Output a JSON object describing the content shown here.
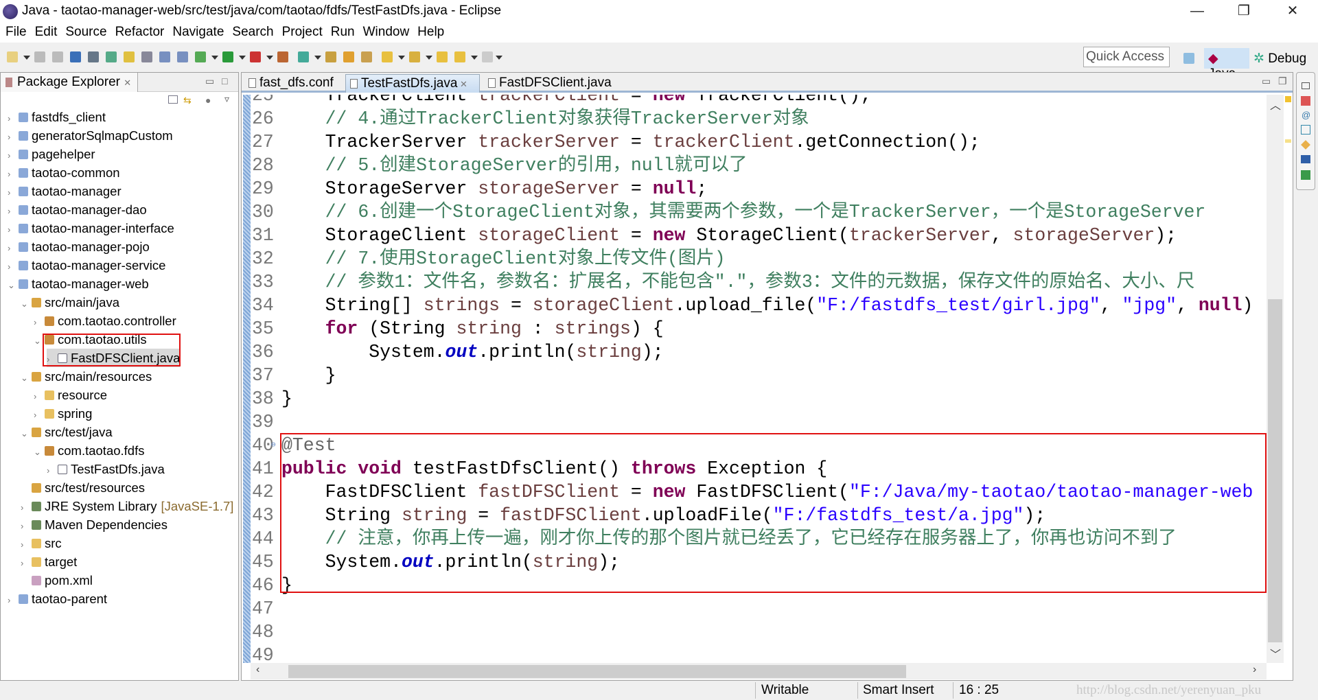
{
  "window": {
    "title": "Java - taotao-manager-web/src/test/java/com/taotao/fdfs/TestFastDfs.java - Eclipse",
    "minimize": "—",
    "restore": "❐",
    "close": "✕"
  },
  "menu": [
    "File",
    "Edit",
    "Source",
    "Refactor",
    "Navigate",
    "Search",
    "Project",
    "Run",
    "Window",
    "Help"
  ],
  "toolbar": {
    "quick_access": "Quick Access",
    "perspectives": {
      "java": "Java",
      "debug": "Debug"
    }
  },
  "package_explorer": {
    "title": "Package Explorer",
    "items": [
      {
        "label": "fastdfs_client",
        "level": 0,
        "state": "collapsed",
        "kind": "project"
      },
      {
        "label": "generatorSqlmapCustom",
        "level": 0,
        "state": "collapsed",
        "kind": "project"
      },
      {
        "label": "pagehelper",
        "level": 0,
        "state": "collapsed",
        "kind": "project"
      },
      {
        "label": "taotao-common",
        "level": 0,
        "state": "collapsed",
        "kind": "project"
      },
      {
        "label": "taotao-manager",
        "level": 0,
        "state": "collapsed",
        "kind": "project"
      },
      {
        "label": "taotao-manager-dao",
        "level": 0,
        "state": "collapsed",
        "kind": "project"
      },
      {
        "label": "taotao-manager-interface",
        "level": 0,
        "state": "collapsed",
        "kind": "project"
      },
      {
        "label": "taotao-manager-pojo",
        "level": 0,
        "state": "collapsed",
        "kind": "project"
      },
      {
        "label": "taotao-manager-service",
        "level": 0,
        "state": "collapsed",
        "kind": "project"
      },
      {
        "label": "taotao-manager-web",
        "level": 0,
        "state": "expanded",
        "kind": "project"
      },
      {
        "label": "src/main/java",
        "level": 1,
        "state": "expanded",
        "kind": "srcfolder"
      },
      {
        "label": "com.taotao.controller",
        "level": 2,
        "state": "collapsed",
        "kind": "package"
      },
      {
        "label": "com.taotao.utils",
        "level": 2,
        "state": "expanded",
        "kind": "package"
      },
      {
        "label": "FastDFSClient.java",
        "level": 3,
        "state": "collapsed",
        "kind": "java",
        "selected": true
      },
      {
        "label": "src/main/resources",
        "level": 1,
        "state": "expanded",
        "kind": "srcfolder"
      },
      {
        "label": "resource",
        "level": 2,
        "state": "collapsed",
        "kind": "folder"
      },
      {
        "label": "spring",
        "level": 2,
        "state": "collapsed",
        "kind": "folder"
      },
      {
        "label": "src/test/java",
        "level": 1,
        "state": "expanded",
        "kind": "srcfolder"
      },
      {
        "label": "com.taotao.fdfs",
        "level": 2,
        "state": "expanded",
        "kind": "package"
      },
      {
        "label": "TestFastDfs.java",
        "level": 3,
        "state": "collapsed",
        "kind": "java"
      },
      {
        "label": "src/test/resources",
        "level": 1,
        "state": "none",
        "kind": "srcfolder"
      },
      {
        "label": "JRE System Library",
        "decoration": "[JavaSE-1.7]",
        "level": 1,
        "state": "collapsed",
        "kind": "library"
      },
      {
        "label": "Maven Dependencies",
        "level": 1,
        "state": "collapsed",
        "kind": "library"
      },
      {
        "label": "src",
        "level": 1,
        "state": "collapsed",
        "kind": "folder"
      },
      {
        "label": "target",
        "level": 1,
        "state": "collapsed",
        "kind": "folder"
      },
      {
        "label": "pom.xml",
        "level": 1,
        "state": "none",
        "kind": "xml"
      },
      {
        "label": "taotao-parent",
        "level": 0,
        "state": "collapsed",
        "kind": "project"
      }
    ]
  },
  "editor": {
    "tabs": [
      {
        "label": "fast_dfs.conf",
        "active": false
      },
      {
        "label": "TestFastDfs.java",
        "active": true
      },
      {
        "label": "FastDFSClient.java",
        "active": false
      }
    ],
    "first_line": 25,
    "lines": [
      [
        [
          "p",
          "    TrackerClient "
        ],
        [
          "var",
          "trackerClient"
        ],
        [
          "p",
          " = "
        ],
        [
          "kw",
          "new"
        ],
        [
          "p",
          " TrackerClient();"
        ]
      ],
      [
        [
          "com",
          "    // 4.通过TrackerClient对象获得TrackerServer对象"
        ]
      ],
      [
        [
          "p",
          "    TrackerServer "
        ],
        [
          "var",
          "trackerServer"
        ],
        [
          "p",
          " = "
        ],
        [
          "var",
          "trackerClient"
        ],
        [
          "p",
          ".getConnection();"
        ]
      ],
      [
        [
          "com",
          "    // 5.创建StorageServer的引用，null就可以了"
        ]
      ],
      [
        [
          "p",
          "    StorageServer "
        ],
        [
          "var",
          "storageServer"
        ],
        [
          "p",
          " = "
        ],
        [
          "kw",
          "null"
        ],
        [
          "p",
          ";"
        ]
      ],
      [
        [
          "com",
          "    // 6.创建一个StorageClient对象，其需要两个参数，一个是TrackerServer，一个是StorageServer"
        ]
      ],
      [
        [
          "p",
          "    StorageClient "
        ],
        [
          "var",
          "storageClient"
        ],
        [
          "p",
          " = "
        ],
        [
          "kw",
          "new"
        ],
        [
          "p",
          " StorageClient("
        ],
        [
          "var",
          "trackerServer"
        ],
        [
          "p",
          ", "
        ],
        [
          "var",
          "storageServer"
        ],
        [
          "p",
          ");"
        ]
      ],
      [
        [
          "com",
          "    // 7.使用StorageClient对象上传文件(图片)"
        ]
      ],
      [
        [
          "com",
          "    // 参数1：文件名，参数名：扩展名，不能包含\".\"，参数3：文件的元数据，保存文件的原始名、大小、尺"
        ]
      ],
      [
        [
          "p",
          "    String[] "
        ],
        [
          "var",
          "strings"
        ],
        [
          "p",
          " = "
        ],
        [
          "var",
          "storageClient"
        ],
        [
          "p",
          ".upload_file("
        ],
        [
          "str",
          "\"F:/fastdfs_test/girl.jpg\""
        ],
        [
          "p",
          ", "
        ],
        [
          "str",
          "\"jpg\""
        ],
        [
          "p",
          ", "
        ],
        [
          "kw",
          "null"
        ],
        [
          "p",
          ")"
        ]
      ],
      [
        [
          "p",
          "    "
        ],
        [
          "kw",
          "for"
        ],
        [
          "p",
          " (String "
        ],
        [
          "var",
          "string"
        ],
        [
          "p",
          " : "
        ],
        [
          "var",
          "strings"
        ],
        [
          "p",
          ") {"
        ]
      ],
      [
        [
          "p",
          "        System."
        ],
        [
          "static",
          "out"
        ],
        [
          "p",
          ".println("
        ],
        [
          "var",
          "string"
        ],
        [
          "p",
          ");"
        ]
      ],
      [
        [
          "p",
          "    }"
        ]
      ],
      [
        [
          "p",
          "}"
        ]
      ],
      [],
      [
        [
          "ann",
          "@Test"
        ]
      ],
      [
        [
          "kw",
          "public"
        ],
        [
          "p",
          " "
        ],
        [
          "kw",
          "void"
        ],
        [
          "p",
          " testFastDfsClient() "
        ],
        [
          "kw",
          "throws"
        ],
        [
          "p",
          " Exception {"
        ]
      ],
      [
        [
          "p",
          "    FastDFSClient "
        ],
        [
          "var",
          "fastDFSClient"
        ],
        [
          "p",
          " = "
        ],
        [
          "kw",
          "new"
        ],
        [
          "p",
          " FastDFSClient("
        ],
        [
          "str",
          "\"F:/Java/my-taotao/taotao-manager-web"
        ]
      ],
      [
        [
          "p",
          "    String "
        ],
        [
          "var",
          "string"
        ],
        [
          "p",
          " = "
        ],
        [
          "var",
          "fastDFSClient"
        ],
        [
          "p",
          ".uploadFile("
        ],
        [
          "str",
          "\"F:/fastdfs_test/a.jpg\""
        ],
        [
          "p",
          ");"
        ]
      ],
      [
        [
          "com",
          "    // 注意，你再上传一遍，刚才你上传的那个图片就已经丢了，它已经存在服务器上了，你再也访问不到了"
        ]
      ],
      [
        [
          "p",
          "    System."
        ],
        [
          "static",
          "out"
        ],
        [
          "p",
          ".println("
        ],
        [
          "var",
          "string"
        ],
        [
          "p",
          ");"
        ]
      ],
      [
        [
          "p",
          "}"
        ]
      ],
      [],
      [],
      []
    ]
  },
  "status": {
    "writable": "Writable",
    "insert_mode": "Smart Insert",
    "position": "16 : 25",
    "watermark": "http://blog.csdn.net/yerenyuan_pku"
  },
  "colors": {
    "keyword": "#7f0055",
    "string": "#2a00ff",
    "comment": "#3f7f5f",
    "variable": "#6a3e3e",
    "static_field": "#0000c0",
    "highlight_box": "#e01010"
  }
}
